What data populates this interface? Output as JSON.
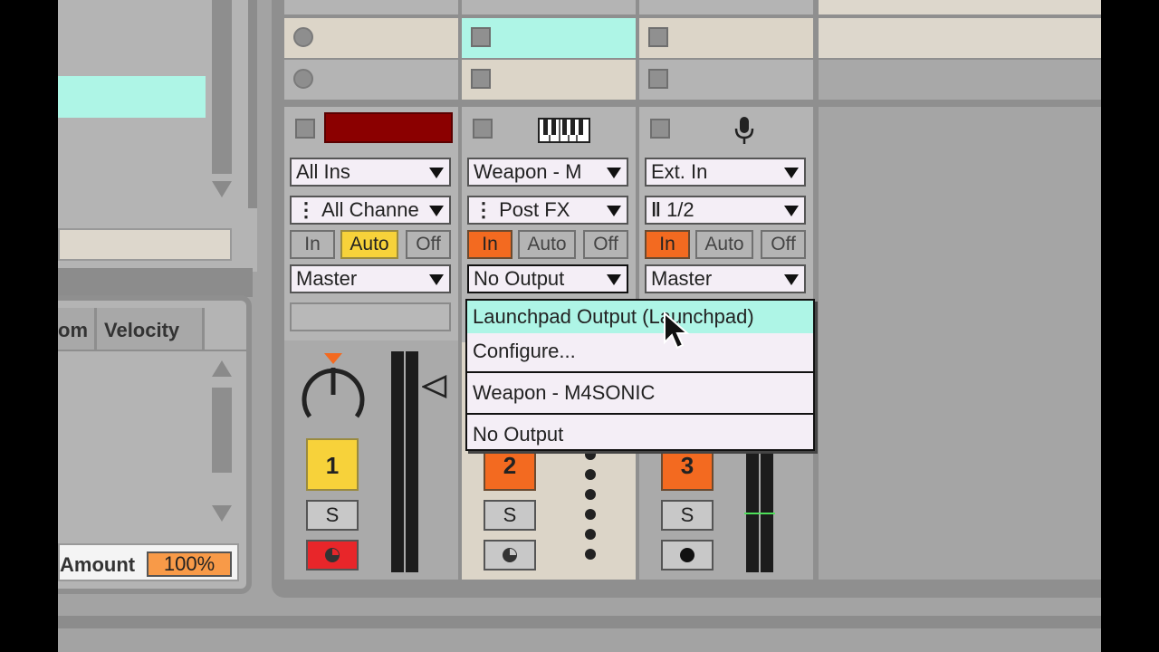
{
  "tracks": [
    {
      "number": "1",
      "input_type": "All Ins",
      "input_channel": "All Channe",
      "monitor": {
        "in": "In",
        "auto": "Auto",
        "off": "Off",
        "active": "auto"
      },
      "output": "Master",
      "solo": "S",
      "title_color": "#8b0000"
    },
    {
      "number": "2",
      "input_type": "Weapon - M",
      "input_channel": "Post FX",
      "monitor": {
        "in": "In",
        "auto": "Auto",
        "off": "Off",
        "active": "in"
      },
      "output": "No Output",
      "solo": "S"
    },
    {
      "number": "3",
      "input_type": "Ext. In",
      "input_channel": "1/2",
      "monitor": {
        "in": "In",
        "auto": "Auto",
        "off": "Off",
        "active": "in"
      },
      "output": "Master",
      "solo": "S"
    }
  ],
  "browser": {
    "column_partial": "om",
    "column_velocity": "Velocity",
    "amount_label": "Amount",
    "amount_value": "100%"
  },
  "output_menu": {
    "items": [
      {
        "label": "Launchpad Output (Launchpad)",
        "highlighted": true
      },
      {
        "label": "Configure..."
      },
      {
        "label": "Weapon - M4SONIC"
      },
      {
        "label": "No Output"
      }
    ]
  },
  "colors": {
    "arm_active": "#f36a20",
    "monitor_auto_on": "#f7d23a",
    "clip_selected": "#aef5e6",
    "record_red": "#e8262a"
  },
  "icons": {
    "track2_input": "piano-keyboard-icon",
    "track3_input": "microphone-icon",
    "cursor": "mouse-pointer-icon"
  }
}
